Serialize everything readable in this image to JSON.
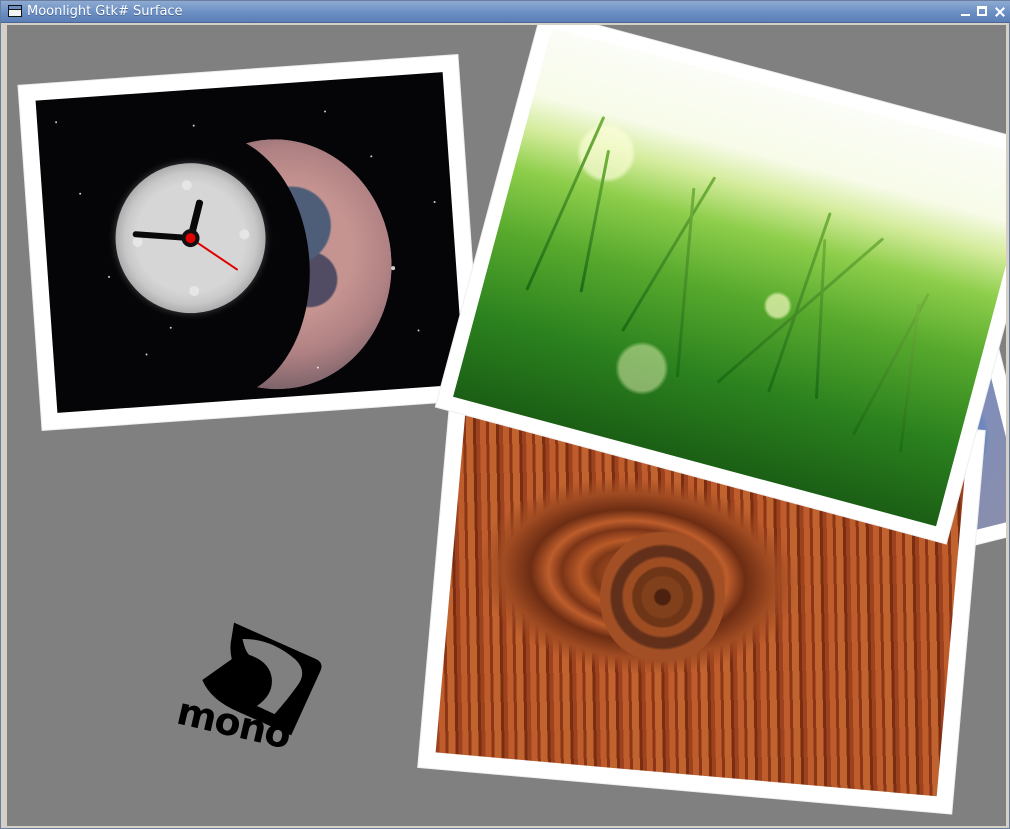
{
  "window": {
    "title": "Moonlight Gtk# Surface",
    "controls": {
      "minimize": "minimize-button",
      "maximize": "maximize-button",
      "close": "close-button"
    }
  },
  "logo": {
    "text": "mono",
    "trademark": "™"
  },
  "photos": [
    {
      "name": "moon photo"
    },
    {
      "name": "grass photo"
    },
    {
      "name": "wood photo"
    },
    {
      "name": "stones photo"
    }
  ],
  "clock": {
    "hour_hand_angle": -72,
    "minute_hand_angle": -172,
    "second_hand_angle": 38
  },
  "colors": {
    "surface": "#808080",
    "titlebar": "#6b8fc4",
    "photo_border": "#ffffff",
    "clock_second_hand": "#e00000"
  }
}
